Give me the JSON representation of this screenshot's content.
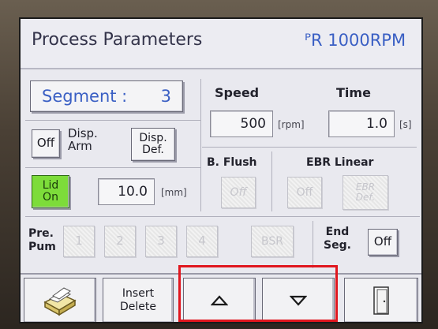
{
  "header": {
    "title": "Process Parameters",
    "scroll_text": "ᴾR 1000RPM"
  },
  "segment": {
    "label": "Segment :",
    "value": "3"
  },
  "disp_arm": {
    "toggle": "Off",
    "label_line1": "Disp.",
    "label_line2": "Arm",
    "def_line1": "Disp.",
    "def_line2": "Def."
  },
  "lid": {
    "line1": "Lid",
    "line2": "On",
    "value": "10.0",
    "unit": "[mm]"
  },
  "speed": {
    "label": "Speed",
    "value": "500",
    "unit": "[rpm]"
  },
  "time": {
    "label": "Time",
    "value": "1.0",
    "unit": "[s]"
  },
  "b_flush": {
    "label": "B. Flush",
    "button": "Off"
  },
  "ebr": {
    "label": "EBR Linear",
    "button": "Off",
    "def_line1": "EBR",
    "def_line2": "Def."
  },
  "pre_pump": {
    "label_line1": "Pre.",
    "label_line2": "Pum",
    "buttons": [
      "1",
      "2",
      "3",
      "4"
    ],
    "bsr": "BSR"
  },
  "end_seg": {
    "label_line1": "End",
    "label_line2": "Seg.",
    "button": "Off"
  },
  "bottom": {
    "insert_line1": "Insert",
    "insert_line2": "Delete"
  },
  "colors": {
    "accent_blue": "#3a5fc4",
    "lid_green": "#7ddc3a",
    "highlight_red": "#e0161e"
  }
}
